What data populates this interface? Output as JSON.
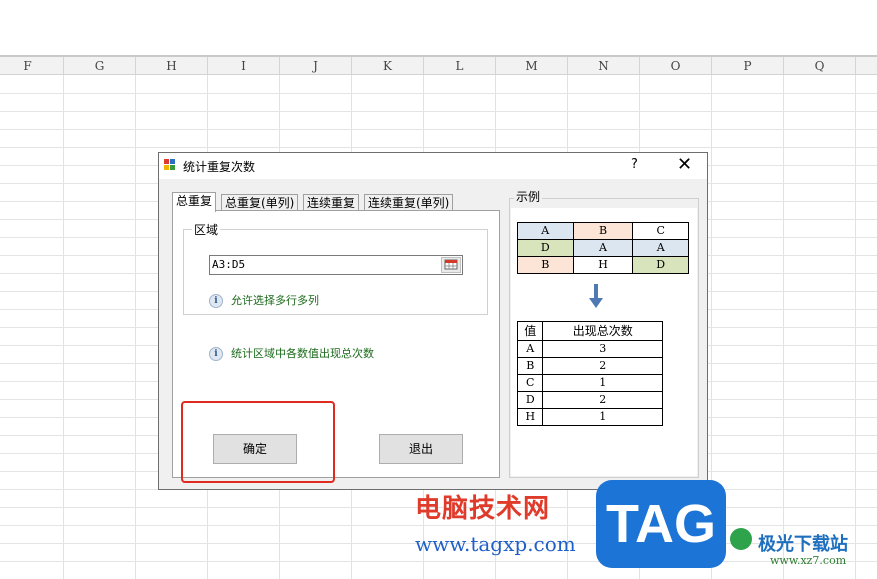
{
  "spreadsheet": {
    "columns": [
      "F",
      "G",
      "H",
      "I",
      "J",
      "K",
      "L",
      "M",
      "N",
      "O",
      "P",
      "Q"
    ]
  },
  "dialog": {
    "title": "统计重复次数",
    "help_label": "?",
    "close_label": "✕",
    "tabs": [
      {
        "label": "总重复",
        "active": true
      },
      {
        "label": "总重复(单列)",
        "active": false
      },
      {
        "label": "连续重复",
        "active": false
      },
      {
        "label": "连续重复(单列)",
        "active": false
      }
    ],
    "region": {
      "label": "区域",
      "value": "A3:D5",
      "hint": "允许选择多行多列"
    },
    "description": "统计区域中各数值出现总次数",
    "ok_label": "确定",
    "exit_label": "退出",
    "example": {
      "label": "示例",
      "source_table": [
        [
          {
            "v": "A",
            "c": "#dce6f1"
          },
          {
            "v": "B",
            "c": "#fce4d6"
          },
          {
            "v": "C",
            "c": "#ffffff"
          }
        ],
        [
          {
            "v": "D",
            "c": "#d8e4bc"
          },
          {
            "v": "A",
            "c": "#dce6f1"
          },
          {
            "v": "A",
            "c": "#dce6f1"
          }
        ],
        [
          {
            "v": "B",
            "c": "#fce4d6"
          },
          {
            "v": "H",
            "c": "#ffffff"
          },
          {
            "v": "D",
            "c": "#d8e4bc"
          }
        ]
      ],
      "result_header": [
        "值",
        "出现总次数"
      ],
      "result_rows": [
        [
          "A",
          "3"
        ],
        [
          "B",
          "2"
        ],
        [
          "C",
          "1"
        ],
        [
          "D",
          "2"
        ],
        [
          "H",
          "1"
        ]
      ]
    }
  },
  "watermark": {
    "title": "电脑技术网",
    "url": "www.tagxp.com",
    "tag_text": "TAG",
    "site_name": "极光下载站",
    "site_url": "www.xz7.com"
  }
}
